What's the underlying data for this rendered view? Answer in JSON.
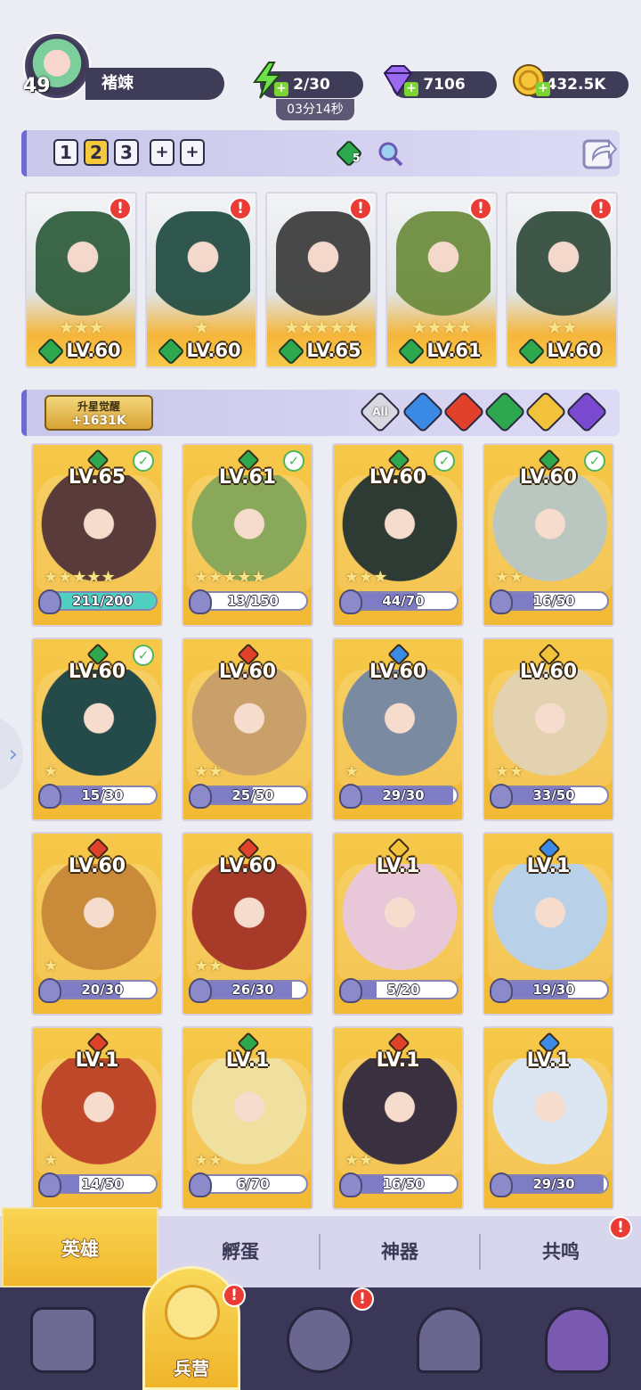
{
  "player": {
    "level": "49",
    "name": "褚竦"
  },
  "resources": {
    "energy": "2/30",
    "energy_timer": "03分14秒",
    "gems": "7106",
    "gold": "432.5K"
  },
  "teams": {
    "tabs": [
      "1",
      "2",
      "3"
    ],
    "active_tab": "2",
    "element_count": "5",
    "slots": [
      {
        "level": "LV.60",
        "stars": "★★★",
        "art_color": "#2c5a3a",
        "has_alert": true
      },
      {
        "level": "LV.60",
        "stars": "★",
        "art_color": "#1f4a40",
        "has_alert": true
      },
      {
        "level": "LV.65",
        "stars": "★★★★★",
        "art_color": "#3a3a3a",
        "has_alert": true
      },
      {
        "level": "LV.61",
        "stars": "★★★★",
        "art_color": "#6a8a3a",
        "has_alert": true
      },
      {
        "level": "LV.60",
        "stars": "★★",
        "art_color": "#2f4a3a",
        "has_alert": true
      }
    ]
  },
  "filter": {
    "awaken_title": "升星觉醒",
    "awaken_value": "+1631K",
    "elements": [
      {
        "name": "all",
        "label": "All",
        "color": "#d8d8e0"
      },
      {
        "name": "water",
        "color": "#3b8ae6"
      },
      {
        "name": "fire",
        "color": "#e1402b"
      },
      {
        "name": "nature",
        "color": "#2ea84e"
      },
      {
        "name": "light",
        "color": "#f2c23a"
      },
      {
        "name": "dark",
        "color": "#7a4ad0"
      }
    ]
  },
  "heroes": [
    {
      "level": "LV.65",
      "element": "#2ea84e",
      "checked": true,
      "stars": "★★★★★",
      "shards": "211/200",
      "fill": 1.0,
      "art": "#5a3b3b"
    },
    {
      "level": "LV.61",
      "element": "#2ea84e",
      "checked": true,
      "stars": "★★★★★",
      "shards": "13/150",
      "fill": 0.087,
      "art": "#8aa85a"
    },
    {
      "level": "LV.60",
      "element": "#2ea84e",
      "checked": true,
      "stars": "★★★",
      "shards": "44/70",
      "fill": 0.63,
      "art": "#2d3b34"
    },
    {
      "level": "LV.60",
      "element": "#2ea84e",
      "checked": true,
      "stars": "★★",
      "shards": "16/50",
      "fill": 0.32,
      "art": "#b9c7c0"
    },
    {
      "level": "LV.60",
      "element": "#2ea84e",
      "checked": true,
      "stars": "★",
      "shards": "15/30",
      "fill": 0.5,
      "art": "#244a4a"
    },
    {
      "level": "LV.60",
      "element": "#e1402b",
      "checked": false,
      "stars": "★★",
      "shards": "25/50",
      "fill": 0.5,
      "art": "#c9a06a"
    },
    {
      "level": "LV.60",
      "element": "#3b8ae6",
      "checked": false,
      "stars": "★",
      "shards": "29/30",
      "fill": 0.967,
      "art": "#7a8aa0"
    },
    {
      "level": "LV.60",
      "element": "#f2c23a",
      "checked": false,
      "stars": "★★",
      "shards": "33/50",
      "fill": 0.66,
      "art": "#e2d2b0"
    },
    {
      "level": "LV.60",
      "element": "#e1402b",
      "checked": false,
      "stars": "★",
      "shards": "20/30",
      "fill": 0.667,
      "art": "#c98a3a"
    },
    {
      "level": "LV.60",
      "element": "#e1402b",
      "checked": false,
      "stars": "★★",
      "shards": "26/30",
      "fill": 0.867,
      "art": "#a83a2a"
    },
    {
      "level": "LV.1",
      "element": "#f2c23a",
      "checked": false,
      "stars": "",
      "shards": "5/20",
      "fill": 0.25,
      "art": "#e8c8d8"
    },
    {
      "level": "LV.1",
      "element": "#3b8ae6",
      "checked": false,
      "stars": "",
      "shards": "19/30",
      "fill": 0.633,
      "art": "#b8d0e8"
    },
    {
      "level": "LV.1",
      "element": "#e1402b",
      "checked": false,
      "stars": "★",
      "shards": "14/50",
      "fill": 0.28,
      "art": "#c0482a"
    },
    {
      "level": "LV.1",
      "element": "#2ea84e",
      "checked": false,
      "stars": "★★",
      "shards": "6/70",
      "fill": 0.086,
      "art": "#f0e0a0"
    },
    {
      "level": "LV.1",
      "element": "#e1402b",
      "checked": false,
      "stars": "★★",
      "shards": "16/50",
      "fill": 0.32,
      "art": "#3a3040"
    },
    {
      "level": "LV.1",
      "element": "#3b8ae6",
      "checked": false,
      "stars": "",
      "shards": "29/30",
      "fill": 0.967,
      "art": "#dce6f2"
    }
  ],
  "sub_tabs": [
    "英雄",
    "孵蛋",
    "神器",
    "共鸣"
  ],
  "nav": {
    "active_label": "兵营",
    "items": [
      "cards-icon",
      "barracks-icon",
      "map-icon",
      "castle-icon",
      "mushroom-icon"
    ]
  }
}
